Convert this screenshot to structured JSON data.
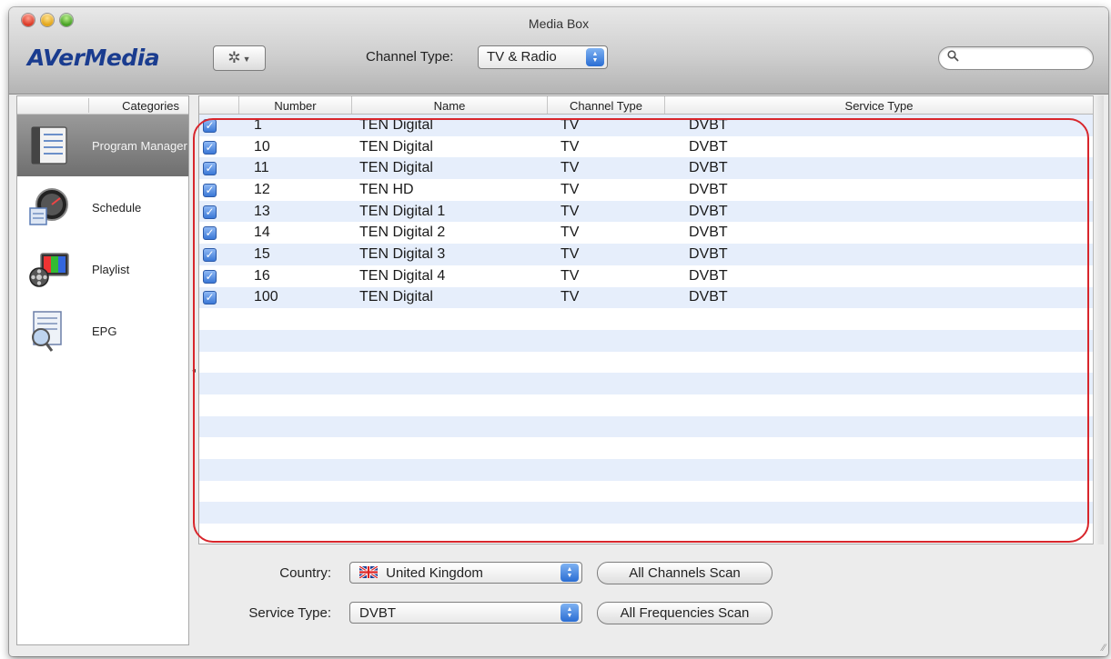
{
  "window": {
    "title": "Media Box"
  },
  "toolbar": {
    "logo_text": "AVerMedia",
    "gear_glyph": "✲",
    "channel_type_label": "Channel Type:",
    "channel_type_value": "TV & Radio",
    "search_placeholder": ""
  },
  "sidebar": {
    "header": "Categories",
    "items": [
      {
        "label": "Program Manager",
        "icon": "program-manager-icon",
        "selected": true
      },
      {
        "label": "Schedule",
        "icon": "schedule-icon",
        "selected": false
      },
      {
        "label": "Playlist",
        "icon": "playlist-icon",
        "selected": false
      },
      {
        "label": "EPG",
        "icon": "epg-icon",
        "selected": false
      }
    ]
  },
  "table": {
    "columns": [
      "",
      "Number",
      "Name",
      "Channel Type",
      "Service Type"
    ],
    "rows": [
      {
        "checked": true,
        "number": "1",
        "name": "TEN Digital",
        "channel_type": "TV",
        "service_type": "DVBT"
      },
      {
        "checked": true,
        "number": "10",
        "name": "TEN Digital",
        "channel_type": "TV",
        "service_type": "DVBT"
      },
      {
        "checked": true,
        "number": "11",
        "name": "TEN Digital",
        "channel_type": "TV",
        "service_type": "DVBT"
      },
      {
        "checked": true,
        "number": "12",
        "name": "TEN HD",
        "channel_type": "TV",
        "service_type": "DVBT"
      },
      {
        "checked": true,
        "number": "13",
        "name": "TEN Digital 1",
        "channel_type": "TV",
        "service_type": "DVBT"
      },
      {
        "checked": true,
        "number": "14",
        "name": "TEN Digital 2",
        "channel_type": "TV",
        "service_type": "DVBT"
      },
      {
        "checked": true,
        "number": "15",
        "name": "TEN Digital 3",
        "channel_type": "TV",
        "service_type": "DVBT"
      },
      {
        "checked": true,
        "number": "16",
        "name": "TEN Digital 4",
        "channel_type": "TV",
        "service_type": "DVBT"
      },
      {
        "checked": true,
        "number": "100",
        "name": "TEN Digital",
        "channel_type": "TV",
        "service_type": "DVBT"
      }
    ],
    "empty_rows": 11
  },
  "bottom": {
    "country_label": "Country:",
    "country_value": "United Kingdom",
    "service_type_label": "Service Type:",
    "service_type_value": "DVBT",
    "all_channels_scan": "All Channels Scan",
    "all_frequencies_scan": "All Frequencies Scan"
  },
  "colors": {
    "logo": "#1a3c8f",
    "highlight": "#d8262c",
    "row_stripe": "#e6eefb",
    "checkbox": "#3a78d6"
  }
}
